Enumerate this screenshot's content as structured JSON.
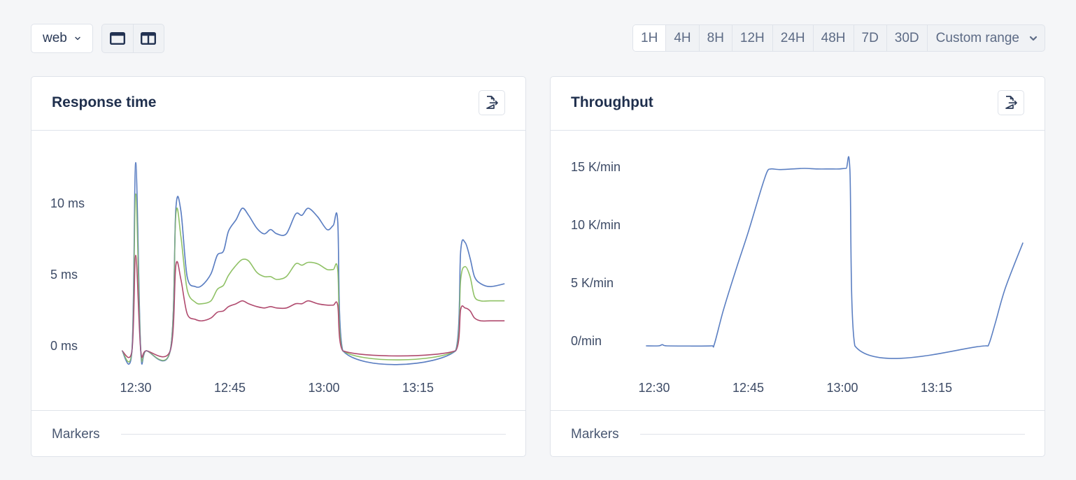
{
  "toolbar": {
    "environment_select": {
      "value": "web",
      "icon": "chevron-down-icon"
    },
    "layout_buttons": [
      {
        "name": "single-column-layout",
        "icon": "single-column-icon"
      },
      {
        "name": "two-column-layout",
        "icon": "two-column-icon"
      }
    ],
    "time_ranges": [
      {
        "label": "1H",
        "active": true
      },
      {
        "label": "4H",
        "active": false
      },
      {
        "label": "8H",
        "active": false
      },
      {
        "label": "12H",
        "active": false
      },
      {
        "label": "24H",
        "active": false
      },
      {
        "label": "48H",
        "active": false
      },
      {
        "label": "7D",
        "active": false
      },
      {
        "label": "30D",
        "active": false
      }
    ],
    "custom_range_label": "Custom range"
  },
  "panels": [
    {
      "title": "Response time",
      "export_icon": "export-file-icon",
      "markers_label": "Markers"
    },
    {
      "title": "Throughput",
      "export_icon": "export-file-icon",
      "markers_label": "Markers"
    }
  ],
  "colors": {
    "series_blue": "#5b7fc2",
    "series_green": "#8fc165",
    "series_maroon": "#b04a6e"
  },
  "chart_data": [
    {
      "type": "line",
      "title": "Response time",
      "xlabel": "",
      "ylabel": "",
      "x_unit": "minutes after 12:30",
      "x_ticks": [
        {
          "value": 0,
          "label": "12:30"
        },
        {
          "value": 15,
          "label": "12:45"
        },
        {
          "value": 30,
          "label": "13:00"
        },
        {
          "value": 45,
          "label": "13:15"
        }
      ],
      "y_ticks": [
        {
          "value": 0,
          "label": "0 ms"
        },
        {
          "value": 5,
          "label": "5 ms"
        },
        {
          "value": 10,
          "label": "10 ms"
        }
      ],
      "xlim": [
        -2.2,
        58.8
      ],
      "ylim": [
        0,
        13.5
      ],
      "grid": false,
      "legend": "none",
      "x": [
        -2.2,
        -0.6,
        0.0,
        0.8,
        1.7,
        5.5,
        6.4,
        7.2,
        8.2,
        9.5,
        10.6,
        12.0,
        13.0,
        14.0,
        14.8,
        16.0,
        17.0,
        18.0,
        19.3,
        20.5,
        21.5,
        22.5,
        24.0,
        25.5,
        26.5,
        27.5,
        29.0,
        30.5,
        31.5,
        32.2,
        33.0,
        51.0,
        51.8,
        52.5,
        53.3,
        54.0,
        55.0,
        56.5,
        58.8
      ],
      "series": [
        {
          "name": "blue",
          "color": "#5b7fc2",
          "values": [
            0,
            0,
            13.2,
            0,
            0,
            0,
            10.0,
            9.8,
            5.2,
            4.5,
            4.6,
            5.4,
            6.7,
            7.0,
            8.4,
            9.2,
            10.0,
            9.5,
            8.6,
            8.2,
            8.5,
            8.2,
            8.2,
            9.6,
            9.5,
            10.0,
            9.4,
            8.5,
            8.8,
            9.1,
            0,
            0,
            7.0,
            7.6,
            6.5,
            5.2,
            4.7,
            4.5,
            4.7
          ]
        },
        {
          "name": "green",
          "color": "#8fc165",
          "values": [
            0,
            0,
            11.0,
            0,
            0,
            0,
            9.6,
            8.0,
            4.3,
            3.4,
            3.3,
            3.5,
            4.3,
            4.6,
            5.3,
            6.0,
            6.4,
            6.3,
            5.5,
            5.2,
            5.2,
            5.0,
            5.2,
            6.1,
            6.0,
            6.2,
            6.1,
            5.7,
            5.7,
            5.7,
            0,
            0,
            5.0,
            5.9,
            5.2,
            3.8,
            3.5,
            3.5,
            3.5
          ]
        },
        {
          "name": "maroon",
          "color": "#b04a6e",
          "values": [
            0,
            0,
            6.7,
            0,
            0,
            0,
            6.0,
            5.0,
            2.6,
            2.2,
            2.1,
            2.3,
            2.7,
            2.8,
            3.1,
            3.3,
            3.5,
            3.3,
            3.1,
            3.0,
            3.1,
            3.0,
            3.0,
            3.3,
            3.3,
            3.5,
            3.3,
            3.2,
            3.2,
            3.2,
            0,
            0,
            2.9,
            3.0,
            2.8,
            2.3,
            2.1,
            2.1,
            2.1
          ]
        }
      ]
    },
    {
      "type": "line",
      "title": "Throughput",
      "xlabel": "",
      "ylabel": "",
      "x_unit": "minutes after 12:30",
      "x_ticks": [
        {
          "value": 0,
          "label": "12:30"
        },
        {
          "value": 15,
          "label": "12:45"
        },
        {
          "value": 30,
          "label": "13:00"
        },
        {
          "value": 45,
          "label": "13:15"
        }
      ],
      "y_ticks": [
        {
          "value": 0,
          "label": "0/min"
        },
        {
          "value": 5000,
          "label": "5 K/min"
        },
        {
          "value": 10000,
          "label": "10 K/min"
        },
        {
          "value": 15000,
          "label": "15 K/min"
        }
      ],
      "xlim": [
        -1.3,
        58.8
      ],
      "ylim": [
        0,
        15500
      ],
      "grid": false,
      "legend": "none",
      "x": [
        -1.3,
        0.7,
        1.3,
        2.0,
        9.2,
        9.6,
        11.0,
        13.0,
        15.0,
        17.0,
        18.0,
        18.6,
        20.0,
        22.0,
        24.0,
        26.0,
        28.0,
        29.5,
        30.6,
        31.2,
        32.0,
        52.8,
        53.4,
        54.4,
        56.0,
        58.8
      ],
      "series": [
        {
          "name": "throughput",
          "color": "#5b7fc2",
          "values": [
            0,
            0,
            100,
            0,
            0,
            150,
            3000,
            6500,
            9800,
            13400,
            15000,
            15250,
            15200,
            15250,
            15300,
            15250,
            15250,
            15250,
            15300,
            15200,
            0,
            0,
            200,
            2000,
            5000,
            8900
          ]
        }
      ]
    }
  ]
}
